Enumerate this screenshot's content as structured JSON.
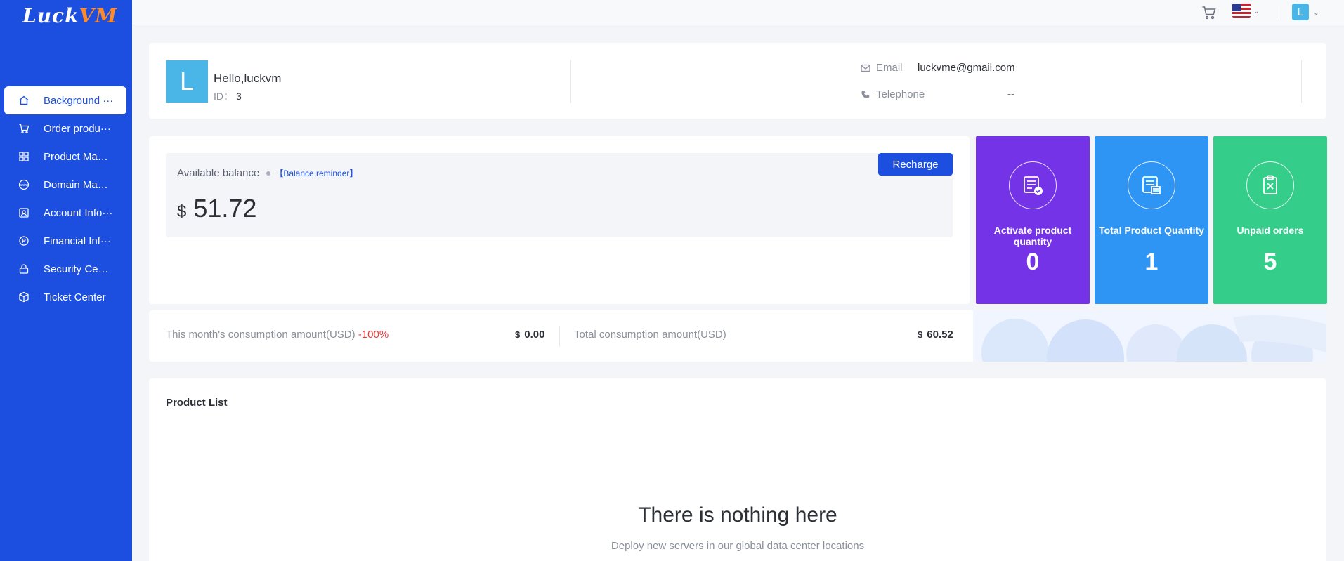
{
  "brand": {
    "logo_main": "Luck",
    "logo_accent": "VM"
  },
  "sidebar": {
    "items": [
      {
        "label": "Background ···",
        "icon": "home-icon",
        "active": true
      },
      {
        "label": "Order produ···",
        "icon": "cart-icon"
      },
      {
        "label": "Product Man···",
        "icon": "grid-icon"
      },
      {
        "label": "Domain Man···",
        "icon": "www-icon"
      },
      {
        "label": "Account Info···",
        "icon": "user-card-icon"
      },
      {
        "label": "Financial Inf···",
        "icon": "currency-icon"
      },
      {
        "label": "Security Cen···",
        "icon": "lock-icon"
      },
      {
        "label": "Ticket Center",
        "icon": "ticket-icon"
      }
    ]
  },
  "header": {
    "user_initial": "L"
  },
  "profile": {
    "initial": "L",
    "greeting": "Hello,luckvm",
    "id_label": "ID：",
    "id_value": "3",
    "email_label": "Email",
    "email_value": "luckvme@gmail.com",
    "phone_label": "Telephone",
    "phone_value": "--"
  },
  "balance": {
    "title": "Available balance",
    "reminder": "【Balance reminder】",
    "currency": "$",
    "amount": "51.72",
    "recharge_label": "Recharge"
  },
  "stats": [
    {
      "label": "Activate product quantity",
      "value": "0",
      "color": "#7433e6",
      "icon": "activate-icon"
    },
    {
      "label": "Total Product Quantity",
      "value": "1",
      "color": "#2e95f5",
      "icon": "server-list-icon"
    },
    {
      "label": "Unpaid orders",
      "value": "5",
      "color": "#35cd8a",
      "icon": "clipboard-x-icon"
    }
  ],
  "consumption": {
    "month_label": "This month's consumption amount(USD)",
    "month_change": "-100%",
    "month_currency": "$",
    "month_value": "0.00",
    "total_label": "Total consumption amount(USD)",
    "total_currency": "$",
    "total_value": "60.52"
  },
  "product_list": {
    "title": "Product List",
    "empty_title": "There is nothing here",
    "empty_subtitle": "Deploy new servers in our global data center locations"
  }
}
